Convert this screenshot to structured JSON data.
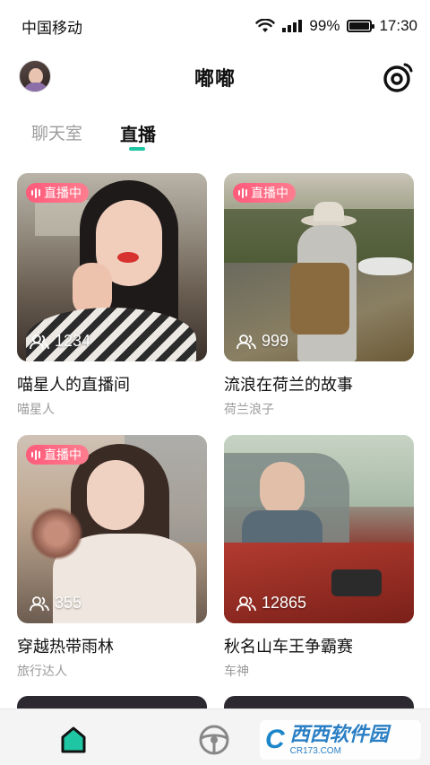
{
  "status_bar": {
    "carrier": "中国移动",
    "battery": "99%",
    "time": "17:30"
  },
  "header": {
    "title": "嘟嘟",
    "avatar_icon": "user-avatar",
    "action_icon": "live-camera-icon"
  },
  "tabs": [
    {
      "label": "聊天室",
      "active": false
    },
    {
      "label": "直播",
      "active": true
    }
  ],
  "accent_color": "#1fc6a3",
  "badge_color": "#ff5a7a",
  "rooms": [
    {
      "badge": "直播中",
      "viewers": "1234",
      "title": "喵星人的直播间",
      "host": "喵星人"
    },
    {
      "badge": "直播中",
      "viewers": "999",
      "title": "流浪在荷兰的故事",
      "host": "荷兰浪子"
    },
    {
      "badge": "直播中",
      "viewers": "355",
      "title": "穿越热带雨林",
      "host": "旅行达人"
    },
    {
      "badge": "",
      "viewers": "12865",
      "title": "秋名山车王争霸赛",
      "host": "车神"
    }
  ],
  "bottom_nav": [
    {
      "icon": "home-icon",
      "active": true
    },
    {
      "icon": "steering-wheel-icon",
      "active": false
    }
  ],
  "watermark": {
    "logo": "C",
    "main": "西西软件园",
    "sub": "CR173.COM"
  }
}
